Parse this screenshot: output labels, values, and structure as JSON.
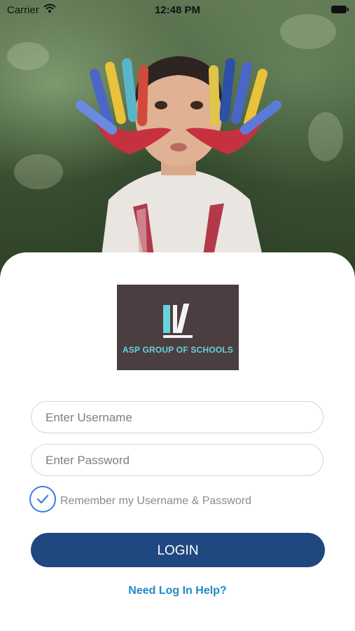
{
  "status_bar": {
    "carrier": "Carrier",
    "time": "12:48 PM",
    "wifi_icon": "wifi-icon",
    "battery_icon": "battery-icon"
  },
  "hero": {
    "image": "child-with-painted-hands-photo"
  },
  "logo": {
    "text": "ASP GROUP OF SCHOOLS",
    "icon": "books-icon",
    "background_color": "#4a3e40",
    "accent_color": "#6ad1df"
  },
  "form": {
    "username": {
      "placeholder": "Enter Username",
      "value": ""
    },
    "password": {
      "placeholder": "Enter Password",
      "value": ""
    },
    "remember": {
      "label": "Remember my Username & Password",
      "checked": true
    },
    "login_label": "LOGIN",
    "help_link": "Need Log In Help?"
  },
  "colors": {
    "primary_button": "#1f4780",
    "link": "#2189c9",
    "checkbox": "#3a7de6"
  }
}
